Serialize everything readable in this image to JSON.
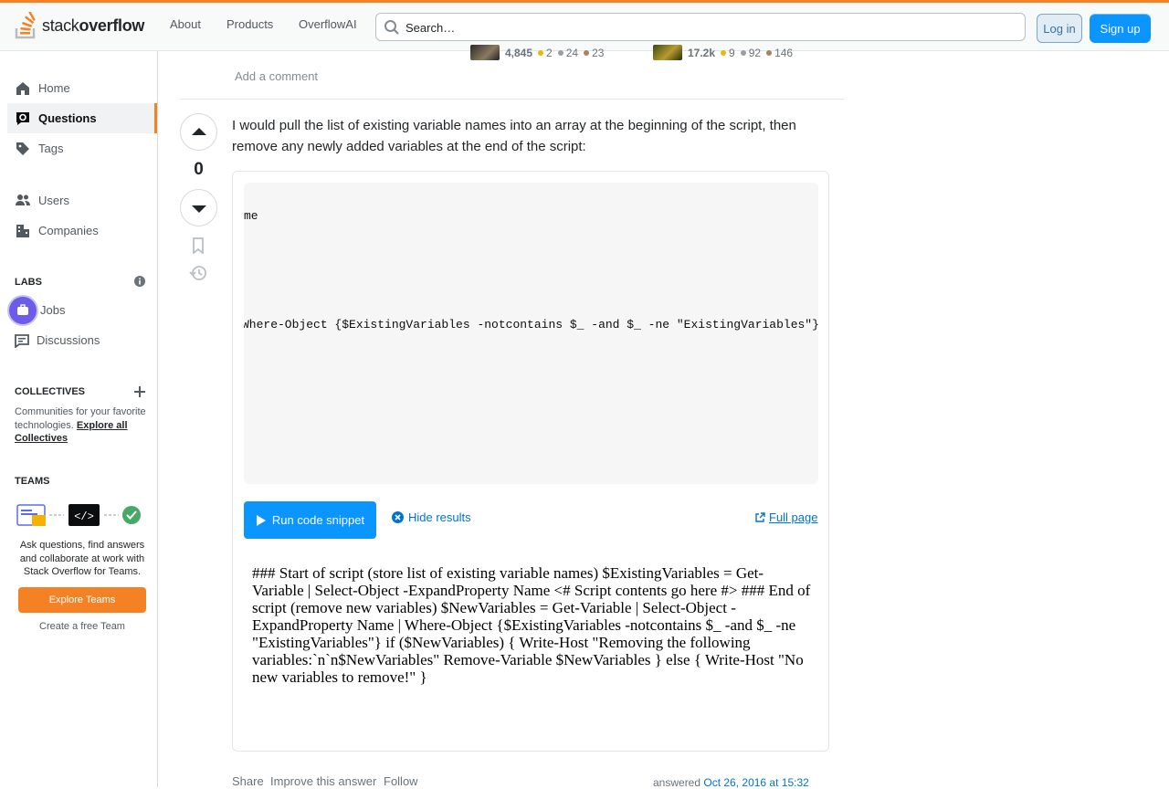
{
  "topbar": {
    "logo_text_light": "stack",
    "logo_text_bold": "overflow",
    "nav": [
      "About",
      "Products",
      "OverflowAI"
    ],
    "search_placeholder": "Search…",
    "login": "Log in",
    "signup": "Sign up"
  },
  "sidebar": {
    "items": [
      {
        "label": "Home",
        "icon": "home-icon"
      },
      {
        "label": "Questions",
        "icon": "questions-icon"
      },
      {
        "label": "Tags",
        "icon": "tag-icon"
      },
      {
        "label": "Users",
        "icon": "users-icon"
      },
      {
        "label": "Companies",
        "icon": "companies-icon"
      }
    ],
    "labs_header": "LABS",
    "labs_items": [
      {
        "label": "Jobs",
        "icon": "jobs-icon"
      },
      {
        "label": "Discussions",
        "icon": "discussions-icon"
      }
    ],
    "collectives_header": "COLLECTIVES",
    "collectives_text": "Communities for your favorite technologies.",
    "collectives_link": "Explore all Collectives",
    "teams_header": "TEAMS",
    "teams_text": "Ask questions, find answers and collaborate at work with Stack Overflow for Teams.",
    "teams_button": "Explore Teams",
    "teams_link": "Create a free Team"
  },
  "users": [
    {
      "rep": "4,845",
      "gold": "2",
      "silver": "24",
      "bronze": "23"
    },
    {
      "rep": "17.2k",
      "gold": "9",
      "silver": "92",
      "bronze": "146"
    }
  ],
  "add_comment": "Add a comment",
  "answer": {
    "votes": "0",
    "body": "I would pull the list of existing variable names into an array at the beginning of the script, then remove any newly added variables at the end of the script:",
    "code_fragment_1": "me",
    "code_fragment_2": "Where-Object {$ExistingVariables -notcontains $_ -and $_ -ne \"ExistingVariables\"}",
    "run_button": "Run code snippet",
    "hide_results": "Hide results",
    "full_page": "Full page",
    "result_text": "### Start of script (store list of existing variable names) $ExistingVariables = Get-Variable | Select-Object -ExpandProperty Name <# Script contents go here #> ### End of script (remove new variables) $NewVariables = Get-Variable | Select-Object -ExpandProperty Name | Where-Object {$ExistingVariables -notcontains $_ -and $_ -ne \"ExistingVariables\"} if ($NewVariables) { Write-Host \"Removing the following variables:`n`n$NewVariables\" Remove-Variable $NewVariables } else { Write-Host \"No new variables to remove!\" }",
    "footer": [
      "Share",
      "Improve this answer",
      "Follow"
    ],
    "answered_prefix": "answered",
    "answered_date": "Oct 26, 2016 at 15:32"
  },
  "colors": {
    "accent": "#f48225",
    "primary": "#0a95ff",
    "gold": "#f1b600",
    "silver": "#9a9ea3",
    "bronze": "#ab825f"
  }
}
